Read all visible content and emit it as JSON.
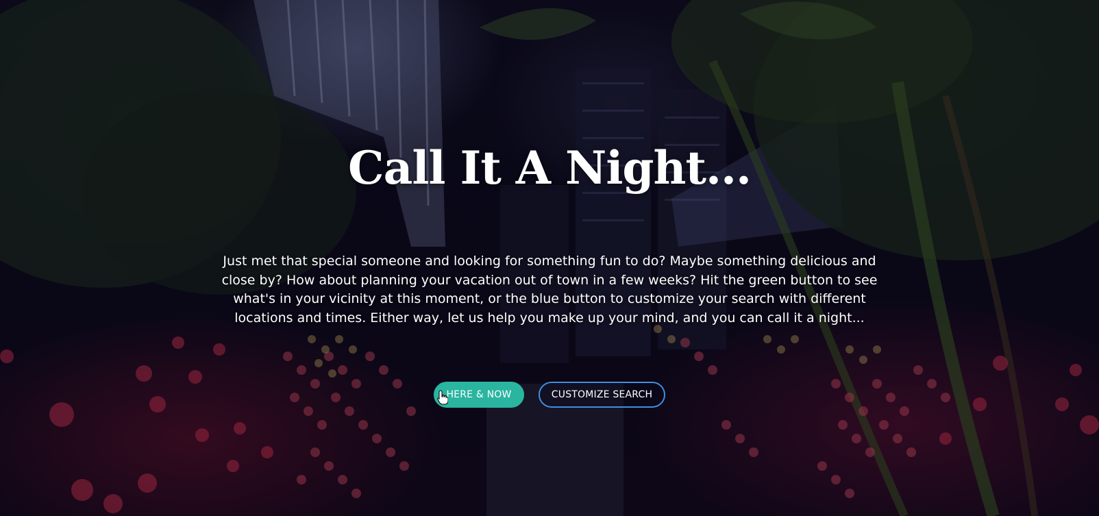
{
  "hero": {
    "title": "Call It A Night...",
    "description": "Just met that special someone and looking for something fun to do? Maybe something delicious and close by? How about planning your vacation out of town in a few weeks? Hit the green button to see what's in your vicinity at this moment, or the blue button to customize your search with different locations and times. Either way, let us help you make up your mind, and you can call it a night..."
  },
  "buttons": {
    "here_now": "HERE & NOW",
    "customize": "CUSTOMIZE SEARCH"
  },
  "colors": {
    "here_now_bg": "#2ab5a0",
    "customize_border": "#3f8fe0"
  },
  "icons": {
    "cursor": "hand-pointer-icon"
  }
}
